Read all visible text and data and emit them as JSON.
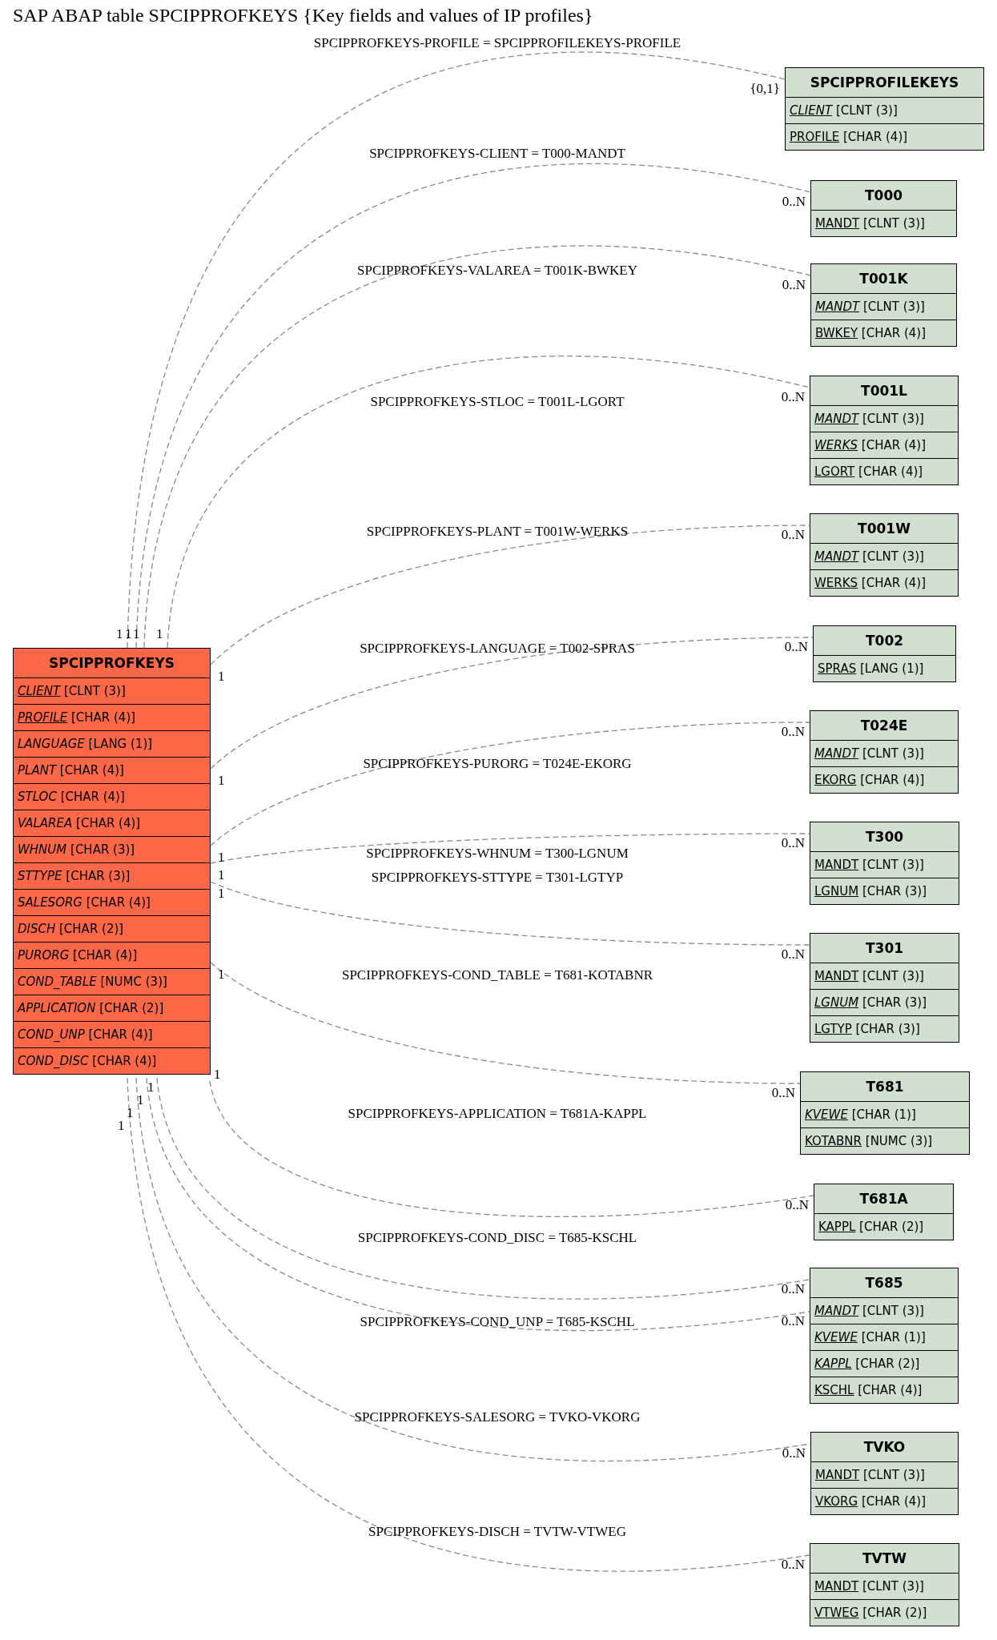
{
  "title": "SAP ABAP table SPCIPPROFKEYS {Key fields and values of IP profiles}",
  "main_table": {
    "name": "SPCIPPROFKEYS",
    "fields": [
      {
        "name": "CLIENT",
        "type": "[CLNT (3)]",
        "key": true,
        "foreign": true
      },
      {
        "name": "PROFILE",
        "type": "[CHAR (4)]",
        "key": true,
        "foreign": true
      },
      {
        "name": "LANGUAGE",
        "type": "[LANG (1)]",
        "key": false,
        "foreign": true
      },
      {
        "name": "PLANT",
        "type": "[CHAR (4)]",
        "key": false,
        "foreign": true
      },
      {
        "name": "STLOC",
        "type": "[CHAR (4)]",
        "key": false,
        "foreign": true
      },
      {
        "name": "VALAREA",
        "type": "[CHAR (4)]",
        "key": false,
        "foreign": true
      },
      {
        "name": "WHNUM",
        "type": "[CHAR (3)]",
        "key": false,
        "foreign": true
      },
      {
        "name": "STTYPE",
        "type": "[CHAR (3)]",
        "key": false,
        "foreign": true
      },
      {
        "name": "SALESORG",
        "type": "[CHAR (4)]",
        "key": false,
        "foreign": true
      },
      {
        "name": "DISCH",
        "type": "[CHAR (2)]",
        "key": false,
        "foreign": true
      },
      {
        "name": "PURORG",
        "type": "[CHAR (4)]",
        "key": false,
        "foreign": true
      },
      {
        "name": "COND_TABLE",
        "type": "[NUMC (3)]",
        "key": false,
        "foreign": true
      },
      {
        "name": "APPLICATION",
        "type": "[CHAR (2)]",
        "key": false,
        "foreign": true
      },
      {
        "name": "COND_UNP",
        "type": "[CHAR (4)]",
        "key": false,
        "foreign": true
      },
      {
        "name": "COND_DISC",
        "type": "[CHAR (4)]",
        "key": false,
        "foreign": true
      }
    ]
  },
  "related_tables": [
    {
      "name": "SPCIPPROFILEKEYS",
      "fields": [
        {
          "name": "CLIENT",
          "type": "[CLNT (3)]",
          "key": true,
          "foreign": true
        },
        {
          "name": "PROFILE",
          "type": "[CHAR (4)]",
          "key": true,
          "foreign": false
        }
      ]
    },
    {
      "name": "T000",
      "fields": [
        {
          "name": "MANDT",
          "type": "[CLNT (3)]",
          "key": true,
          "foreign": false
        }
      ]
    },
    {
      "name": "T001K",
      "fields": [
        {
          "name": "MANDT",
          "type": "[CLNT (3)]",
          "key": true,
          "foreign": true
        },
        {
          "name": "BWKEY",
          "type": "[CHAR (4)]",
          "key": true,
          "foreign": false
        }
      ]
    },
    {
      "name": "T001L",
      "fields": [
        {
          "name": "MANDT",
          "type": "[CLNT (3)]",
          "key": true,
          "foreign": true
        },
        {
          "name": "WERKS",
          "type": "[CHAR (4)]",
          "key": true,
          "foreign": true
        },
        {
          "name": "LGORT",
          "type": "[CHAR (4)]",
          "key": true,
          "foreign": false
        }
      ]
    },
    {
      "name": "T001W",
      "fields": [
        {
          "name": "MANDT",
          "type": "[CLNT (3)]",
          "key": true,
          "foreign": true
        },
        {
          "name": "WERKS",
          "type": "[CHAR (4)]",
          "key": true,
          "foreign": false
        }
      ]
    },
    {
      "name": "T002",
      "fields": [
        {
          "name": "SPRAS",
          "type": "[LANG (1)]",
          "key": true,
          "foreign": false
        }
      ]
    },
    {
      "name": "T024E",
      "fields": [
        {
          "name": "MANDT",
          "type": "[CLNT (3)]",
          "key": true,
          "foreign": true
        },
        {
          "name": "EKORG",
          "type": "[CHAR (4)]",
          "key": true,
          "foreign": false
        }
      ]
    },
    {
      "name": "T300",
      "fields": [
        {
          "name": "MANDT",
          "type": "[CLNT (3)]",
          "key": true,
          "foreign": false
        },
        {
          "name": "LGNUM",
          "type": "[CHAR (3)]",
          "key": true,
          "foreign": false
        }
      ]
    },
    {
      "name": "T301",
      "fields": [
        {
          "name": "MANDT",
          "type": "[CLNT (3)]",
          "key": true,
          "foreign": false
        },
        {
          "name": "LGNUM",
          "type": "[CHAR (3)]",
          "key": true,
          "foreign": true
        },
        {
          "name": "LGTYP",
          "type": "[CHAR (3)]",
          "key": true,
          "foreign": false
        }
      ]
    },
    {
      "name": "T681",
      "fields": [
        {
          "name": "KVEWE",
          "type": "[CHAR (1)]",
          "key": true,
          "foreign": true
        },
        {
          "name": "KOTABNR",
          "type": "[NUMC (3)]",
          "key": true,
          "foreign": false
        }
      ]
    },
    {
      "name": "T681A",
      "fields": [
        {
          "name": "KAPPL",
          "type": "[CHAR (2)]",
          "key": true,
          "foreign": false
        }
      ]
    },
    {
      "name": "T685",
      "fields": [
        {
          "name": "MANDT",
          "type": "[CLNT (3)]",
          "key": true,
          "foreign": true
        },
        {
          "name": "KVEWE",
          "type": "[CHAR (1)]",
          "key": true,
          "foreign": true
        },
        {
          "name": "KAPPL",
          "type": "[CHAR (2)]",
          "key": true,
          "foreign": true
        },
        {
          "name": "KSCHL",
          "type": "[CHAR (4)]",
          "key": true,
          "foreign": false
        }
      ]
    },
    {
      "name": "TVKO",
      "fields": [
        {
          "name": "MANDT",
          "type": "[CLNT (3)]",
          "key": true,
          "foreign": false
        },
        {
          "name": "VKORG",
          "type": "[CHAR (4)]",
          "key": true,
          "foreign": false
        }
      ]
    },
    {
      "name": "TVTW",
      "fields": [
        {
          "name": "MANDT",
          "type": "[CLNT (3)]",
          "key": true,
          "foreign": false
        },
        {
          "name": "VTWEG",
          "type": "[CHAR (2)]",
          "key": true,
          "foreign": false
        }
      ]
    }
  ],
  "relations": [
    {
      "label": "SPCIPPROFKEYS-PROFILE = SPCIPPROFILEKEYS-PROFILE",
      "from_card": "1",
      "to_card": "{0,1}"
    },
    {
      "label": "SPCIPPROFKEYS-CLIENT = T000-MANDT",
      "from_card": "1",
      "to_card": "0..N"
    },
    {
      "label": "SPCIPPROFKEYS-VALAREA = T001K-BWKEY",
      "from_card": "1",
      "to_card": "0..N"
    },
    {
      "label": "SPCIPPROFKEYS-STLOC = T001L-LGORT",
      "from_card": "1",
      "to_card": "0..N"
    },
    {
      "label": "SPCIPPROFKEYS-PLANT = T001W-WERKS",
      "from_card": "1",
      "to_card": "0..N"
    },
    {
      "label": "SPCIPPROFKEYS-LANGUAGE = T002-SPRAS",
      "from_card": "1",
      "to_card": "0..N"
    },
    {
      "label": "SPCIPPROFKEYS-PURORG = T024E-EKORG",
      "from_card": "1",
      "to_card": "0..N"
    },
    {
      "label": "SPCIPPROFKEYS-WHNUM = T300-LGNUM",
      "from_card": "1",
      "to_card": "0..N"
    },
    {
      "label": "SPCIPPROFKEYS-STTYPE = T301-LGTYP",
      "from_card": "1",
      "to_card": "0..N"
    },
    {
      "label": "SPCIPPROFKEYS-COND_TABLE = T681-KOTABNR",
      "from_card": "1",
      "to_card": "0..N"
    },
    {
      "label": "SPCIPPROFKEYS-APPLICATION = T681A-KAPPL",
      "from_card": "1",
      "to_card": "0..N"
    },
    {
      "label": "SPCIPPROFKEYS-COND_DISC = T685-KSCHL",
      "from_card": "1",
      "to_card": "0..N"
    },
    {
      "label": "SPCIPPROFKEYS-COND_UNP = T685-KSCHL",
      "from_card": "1",
      "to_card": "0..N"
    },
    {
      "label": "SPCIPPROFKEYS-SALESORG = TVKO-VKORG",
      "from_card": "1",
      "to_card": "0..N"
    },
    {
      "label": "SPCIPPROFKEYS-DISCH = TVTW-VTWEG",
      "from_card": "1",
      "to_card": "0..N"
    }
  ]
}
